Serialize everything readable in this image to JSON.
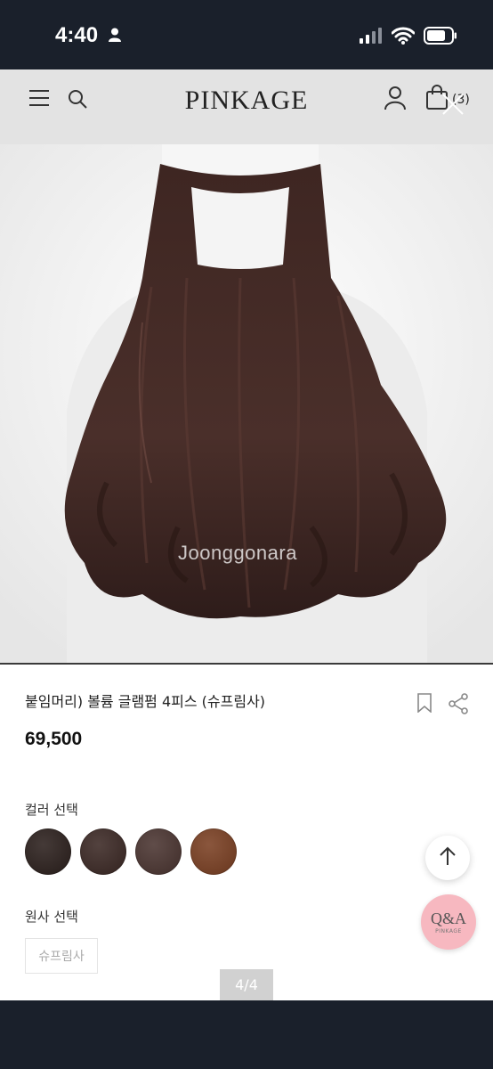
{
  "status_bar": {
    "time": "4:40"
  },
  "site_header": {
    "logo": "PINKAGE",
    "cart_count": "(3)"
  },
  "product_image": {
    "watermark": "Joonggonara",
    "hair_color": "#3a2320"
  },
  "product": {
    "title": "붙임머리) 볼륨 글램펌 4피스 (슈프림사)",
    "price": "69,500"
  },
  "color_section": {
    "label": "컬러 선택",
    "swatches": [
      "#2b1f1c",
      "#3b2824",
      "#4a3430",
      "#7a3f22"
    ]
  },
  "origin_section": {
    "label": "원사 선택",
    "option": "슈프림사"
  },
  "qa_button": {
    "label": "Q&A",
    "sub": "PINKAGE"
  },
  "pager": {
    "indicator": "4/4"
  }
}
